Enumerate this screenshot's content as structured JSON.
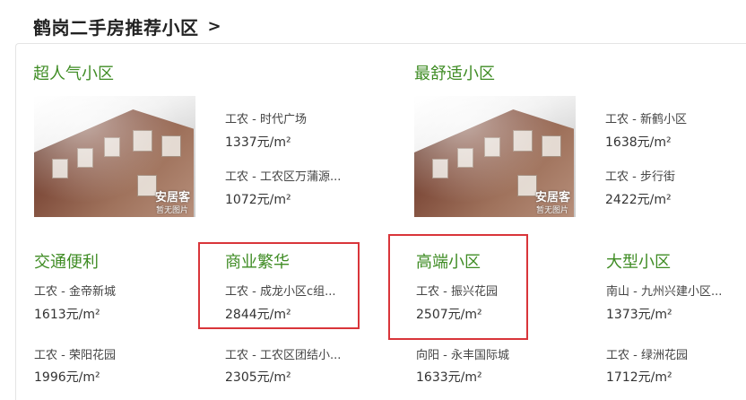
{
  "header": {
    "title": "鹤岗二手房推荐小区",
    "arrow": ">"
  },
  "thumb": {
    "logo": "安居客",
    "no_image": "暂无图片"
  },
  "sections": [
    {
      "title": "超人气小区",
      "items": [
        {
          "name": "工农 - 时代广场",
          "price": "1337元/m²"
        },
        {
          "name": "工农 - 工农区万蒲源...",
          "price": "1072元/m²"
        }
      ]
    },
    {
      "title": "最舒适小区",
      "items": [
        {
          "name": "工农 - 新鹤小区",
          "price": "1638元/m²"
        },
        {
          "name": "工农 - 步行街",
          "price": "2422元/m²"
        }
      ]
    },
    {
      "title": "交通便利",
      "items": [
        {
          "name": "工农 - 金帝新城",
          "price": "1613元/m²"
        },
        {
          "name": "工农 - 荣阳花园",
          "price": "1996元/m²"
        }
      ]
    },
    {
      "title": "商业繁华",
      "items": [
        {
          "name": "工农 - 成龙小区c组...",
          "price": "2844元/m²"
        },
        {
          "name": "工农 - 工农区团结小...",
          "price": "2305元/m²"
        }
      ]
    },
    {
      "title": "高端小区",
      "items": [
        {
          "name": "工农 - 振兴花园",
          "price": "2507元/m²"
        },
        {
          "name": "向阳 - 永丰国际城",
          "price": "1633元/m²"
        }
      ]
    },
    {
      "title": "大型小区",
      "items": [
        {
          "name": "南山 - 九州兴建小区...",
          "price": "1373元/m²"
        },
        {
          "name": "工农 - 绿洲花园",
          "price": "1712元/m²"
        }
      ]
    }
  ],
  "colors": {
    "section_title": "#3f8c24",
    "highlight_box": "#d9353a"
  }
}
